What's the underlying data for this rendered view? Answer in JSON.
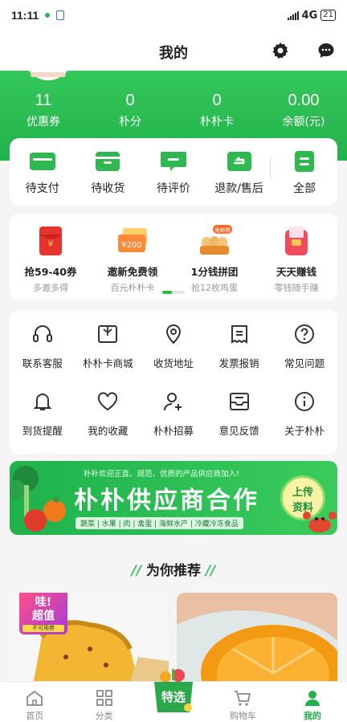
{
  "status_bar": {
    "time": "11:11",
    "network": "4G",
    "battery": "21"
  },
  "header": {
    "title": "我的"
  },
  "stats": [
    {
      "value": "11",
      "label": "优惠券"
    },
    {
      "value": "0",
      "label": "朴分"
    },
    {
      "value": "0",
      "label": "朴朴卡"
    },
    {
      "value": "0.00",
      "label": "余额(元)"
    }
  ],
  "orders": [
    {
      "label": "待支付",
      "icon": "wallet-icon"
    },
    {
      "label": "待收货",
      "icon": "box-icon"
    },
    {
      "label": "待评价",
      "icon": "comment-icon"
    },
    {
      "label": "退款/售后",
      "icon": "refund-icon"
    },
    {
      "label": "全部",
      "icon": "list-icon"
    }
  ],
  "promos": [
    {
      "title": "抢59-40券",
      "subtitle": "多邀多得",
      "icon": "red-envelope-icon"
    },
    {
      "title": "邀新免费领",
      "subtitle": "百元朴朴卡",
      "icon": "gift-card-icon",
      "card_value": "¥200"
    },
    {
      "title": "1分钱拼团",
      "subtitle": "抢12枚鸡蛋",
      "icon": "eggs-icon",
      "tag": "免邮费"
    },
    {
      "title": "天天赚钱",
      "subtitle": "零钱随手赚",
      "icon": "money-pouch-icon"
    }
  ],
  "services": [
    [
      {
        "label": "联系客服",
        "icon": "headset-icon"
      },
      {
        "label": "朴朴卡商城",
        "icon": "gift-icon"
      },
      {
        "label": "收货地址",
        "icon": "location-icon"
      },
      {
        "label": "发票报销",
        "icon": "invoice-icon"
      },
      {
        "label": "常见问题",
        "icon": "question-icon"
      }
    ],
    [
      {
        "label": "到货提醒",
        "icon": "bell-icon"
      },
      {
        "label": "我的收藏",
        "icon": "heart-icon"
      },
      {
        "label": "朴朴招募",
        "icon": "add-user-icon"
      },
      {
        "label": "意见反馈",
        "icon": "feedback-icon"
      },
      {
        "label": "关于朴朴",
        "icon": "info-icon"
      }
    ]
  ],
  "banner": {
    "small_text": "朴朴欢迎正直、规范、优质的产品供应商加入!",
    "headline": "朴朴供应商合作",
    "categories": "蔬菜 | 水果 | 肉 | 禽蛋 | 海鲜水产 | 冷藏冷冻食品",
    "cta_line1": "上传",
    "cta_line2": "资料"
  },
  "recommend": {
    "title": "为你推荐",
    "badge_line1": "哇!",
    "badge_line2": "超值",
    "badge_note": "不可用券"
  },
  "tabbar": [
    {
      "label": "首页",
      "icon": "home-icon"
    },
    {
      "label": "分类",
      "icon": "grid-icon"
    },
    {
      "label": "特选",
      "icon": "tejian-basket-icon"
    },
    {
      "label": "购物车",
      "icon": "cart-icon"
    },
    {
      "label": "我的",
      "icon": "person-icon",
      "active": true
    }
  ],
  "colors": {
    "brand_green": "#22b24c",
    "accent_green": "#2eb84f"
  }
}
